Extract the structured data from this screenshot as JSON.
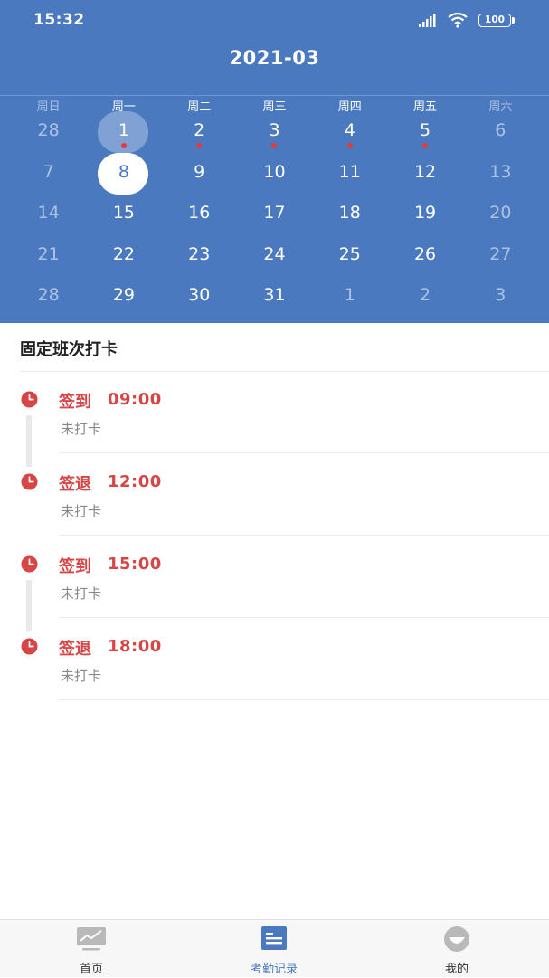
{
  "status_bar": {
    "time": "15:32",
    "battery": "100"
  },
  "header": {
    "month": "2021-03"
  },
  "weekdays": [
    "周日",
    "周一",
    "周二",
    "周三",
    "周四",
    "周五",
    "周六"
  ],
  "calendar": {
    "rows": [
      [
        {
          "d": "28",
          "other": true
        },
        {
          "d": "1",
          "today": true,
          "dot": true
        },
        {
          "d": "2",
          "dot": true
        },
        {
          "d": "3",
          "dot": true
        },
        {
          "d": "4",
          "dot": true
        },
        {
          "d": "5",
          "dot": true
        },
        {
          "d": "6",
          "weekend": true
        }
      ],
      [
        {
          "d": "7",
          "weekend": true
        },
        {
          "d": "8",
          "selected": true
        },
        {
          "d": "9"
        },
        {
          "d": "10"
        },
        {
          "d": "11"
        },
        {
          "d": "12"
        },
        {
          "d": "13",
          "weekend": true
        }
      ],
      [
        {
          "d": "14",
          "weekend": true
        },
        {
          "d": "15"
        },
        {
          "d": "16"
        },
        {
          "d": "17"
        },
        {
          "d": "18"
        },
        {
          "d": "19"
        },
        {
          "d": "20",
          "weekend": true
        }
      ],
      [
        {
          "d": "21",
          "weekend": true
        },
        {
          "d": "22"
        },
        {
          "d": "23"
        },
        {
          "d": "24"
        },
        {
          "d": "25"
        },
        {
          "d": "26"
        },
        {
          "d": "27",
          "weekend": true
        }
      ],
      [
        {
          "d": "28",
          "weekend": true
        },
        {
          "d": "29"
        },
        {
          "d": "30"
        },
        {
          "d": "31"
        },
        {
          "d": "1",
          "other": true
        },
        {
          "d": "2",
          "other": true
        },
        {
          "d": "3",
          "other": true
        }
      ]
    ]
  },
  "section": {
    "title": "固定班次打卡"
  },
  "records": [
    {
      "label": "签到",
      "time": "09:00",
      "status": "未打卡"
    },
    {
      "label": "签退",
      "time": "12:00",
      "status": "未打卡"
    },
    {
      "label": "签到",
      "time": "15:00",
      "status": "未打卡"
    },
    {
      "label": "签退",
      "time": "18:00",
      "status": "未打卡"
    }
  ],
  "tabs": [
    {
      "label": "首页",
      "icon": "chart-icon"
    },
    {
      "label": "考勤记录",
      "icon": "list-icon",
      "active": true
    },
    {
      "label": "我的",
      "icon": "face-icon"
    }
  ],
  "colors": {
    "primary": "#4a79c0",
    "accent_red": "#d74646",
    "dot_red": "#e23b3b"
  }
}
